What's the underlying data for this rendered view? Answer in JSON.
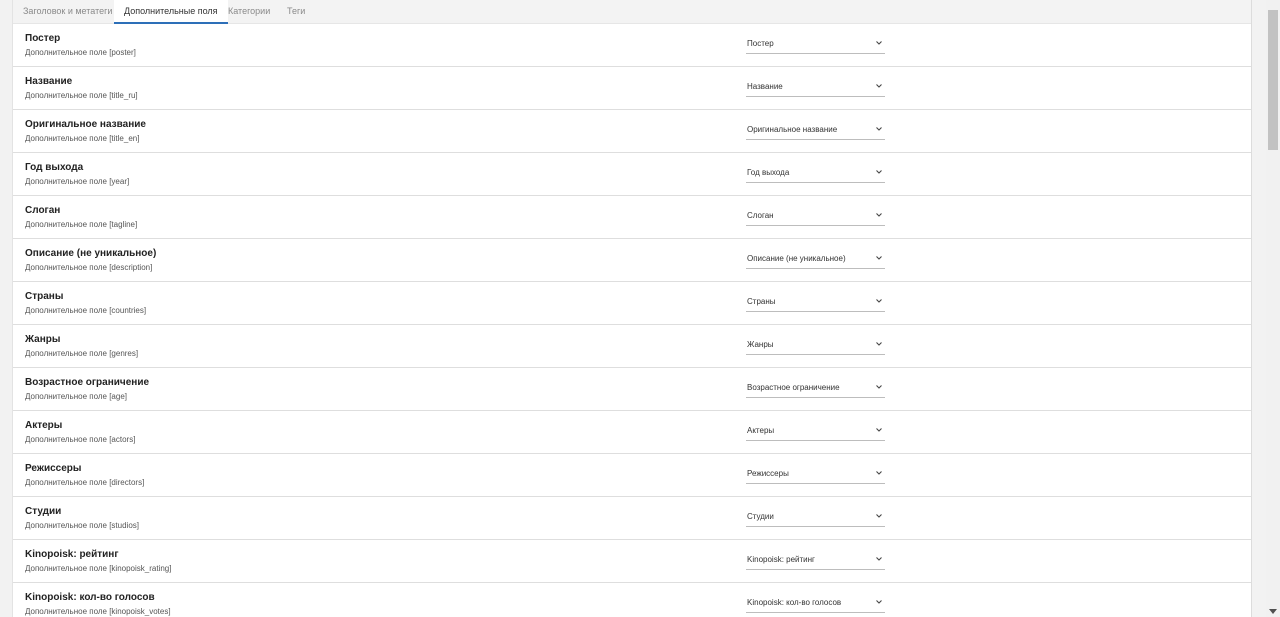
{
  "tabs": [
    {
      "label": "Заголовок и метатеги"
    },
    {
      "label": "Дополнительные поля"
    },
    {
      "label": "Категории"
    },
    {
      "label": "Теги"
    }
  ],
  "active_tab": "Дополнительные поля",
  "field_rows": [
    {
      "title": "Постер",
      "subtitle": "Дополнительное поле [poster]",
      "selected": "Постер"
    },
    {
      "title": "Название",
      "subtitle": "Дополнительное поле [title_ru]",
      "selected": "Название"
    },
    {
      "title": "Оригинальное название",
      "subtitle": "Дополнительное поле [title_en]",
      "selected": "Оригинальное название"
    },
    {
      "title": "Год выхода",
      "subtitle": "Дополнительное поле [year]",
      "selected": "Год выхода"
    },
    {
      "title": "Слоган",
      "subtitle": "Дополнительное поле [tagline]",
      "selected": "Слоган"
    },
    {
      "title": "Описание (не уникальное)",
      "subtitle": "Дополнительное поле [description]",
      "selected": "Описание (не уникальное)"
    },
    {
      "title": "Страны",
      "subtitle": "Дополнительное поле [countries]",
      "selected": "Страны"
    },
    {
      "title": "Жанры",
      "subtitle": "Дополнительное поле [genres]",
      "selected": "Жанры"
    },
    {
      "title": "Возрастное ограничение",
      "subtitle": "Дополнительное поле [age]",
      "selected": "Возрастное ограничение"
    },
    {
      "title": "Актеры",
      "subtitle": "Дополнительное поле [actors]",
      "selected": "Актеры"
    },
    {
      "title": "Режиссеры",
      "subtitle": "Дополнительное поле [directors]",
      "selected": "Режиссеры"
    },
    {
      "title": "Студии",
      "subtitle": "Дополнительное поле [studios]",
      "selected": "Студии"
    },
    {
      "title": "Kinopoisk: рейтинг",
      "subtitle": "Дополнительное поле [kinopoisk_rating]",
      "selected": "Kinopoisk: рейтинг"
    },
    {
      "title": "Kinopoisk: кол-во голосов",
      "subtitle": "Дополнительное поле [kinopoisk_votes]",
      "selected": "Kinopoisk: кол-во голосов"
    }
  ],
  "icons": {
    "select_arrow": "chevron-down-icon",
    "scroll_down": "scroll-down-arrow-icon"
  },
  "colors": {
    "accent": "#2d6fb8",
    "divider": "#dedede",
    "background": "#f2f2f2"
  }
}
